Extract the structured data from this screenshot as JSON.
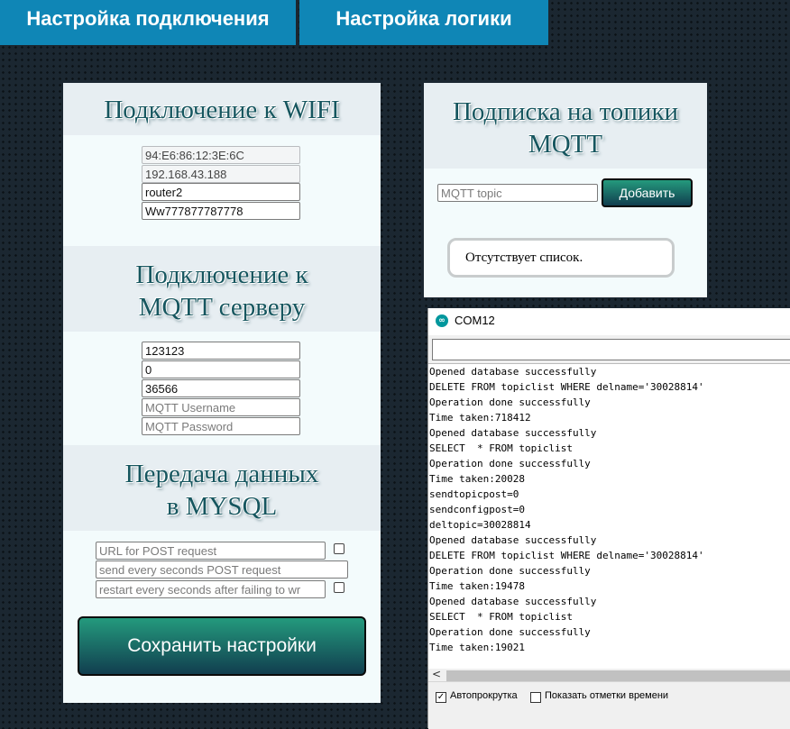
{
  "tabs": {
    "connection": "Настройка подключения",
    "logic": "Настройка логики"
  },
  "wifi": {
    "title": "Подключение к WIFI",
    "mac": "94:E6:86:12:3E:6C",
    "ip": "192.168.43.188",
    "ssid": "router2",
    "password": "Ww777877787778"
  },
  "mqtt": {
    "title_line1": "Подключение к",
    "title_line2": "MQTT серверу",
    "server": "123123",
    "port_field_1": "0",
    "port_field_2": "36566",
    "username_placeholder": "MQTT Username",
    "password_placeholder": "MQTT Password"
  },
  "mysql": {
    "title_line1": "Передача данных",
    "title_line2": "в MYSQL",
    "url_placeholder": "URL for POST request",
    "interval_placeholder": "send every seconds POST request",
    "restart_placeholder": "restart every seconds after failing to wr"
  },
  "save_button": "Сохранить настройки",
  "subscriptions": {
    "title_line1": "Подписка на топики",
    "title_line2": "MQTT",
    "topic_placeholder": "MQTT topic",
    "add_button": "Добавить",
    "empty_message": "Отсутствует список."
  },
  "serial_monitor": {
    "title": "COM12",
    "log": [
      "Opened database successfully",
      "DELETE FROM topiclist WHERE delname='30028814'",
      "Operation done successfully",
      "Time taken:718412",
      "Opened database successfully",
      "SELECT  * FROM topiclist",
      "Operation done successfully",
      "Time taken:20028",
      "sendtopicpost=0",
      "sendconfigpost=0",
      "deltopic=30028814",
      "Opened database successfully",
      "DELETE FROM topiclist WHERE delname='30028814'",
      "Operation done successfully",
      "Time taken:19478",
      "Opened database successfully",
      "SELECT  * FROM topiclist",
      "Operation done successfully",
      "Time taken:19021"
    ],
    "autoscroll_label": "Автопрокрутка",
    "autoscroll_checked": true,
    "timestamps_label": "Показать отметки времени",
    "timestamps_checked": false
  }
}
